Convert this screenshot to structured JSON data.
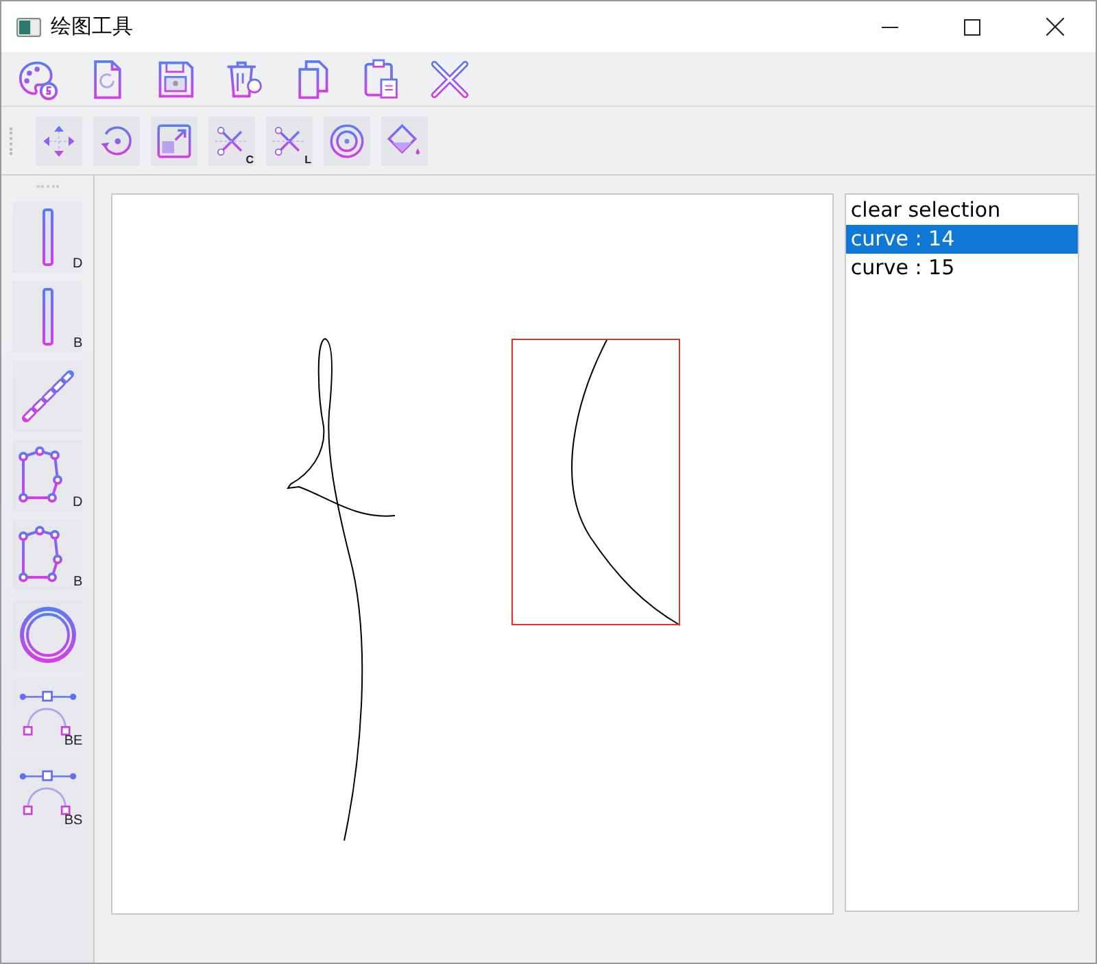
{
  "window": {
    "title": "绘图工具"
  },
  "edit_tools": [
    {
      "kind": "move"
    },
    {
      "kind": "rotate"
    },
    {
      "kind": "scale"
    },
    {
      "kind": "cut",
      "label": "C"
    },
    {
      "kind": "cut",
      "label": "L"
    },
    {
      "kind": "target"
    },
    {
      "kind": "fill"
    }
  ],
  "drawing_tools": [
    {
      "kind": "bar",
      "label": "D"
    },
    {
      "kind": "bar",
      "label": "B"
    },
    {
      "kind": "chain"
    },
    {
      "kind": "polygon",
      "label": "D"
    },
    {
      "kind": "polygon",
      "label": "B"
    },
    {
      "kind": "circle"
    },
    {
      "kind": "bezier",
      "label": "BE"
    },
    {
      "kind": "bezier",
      "label": "BS"
    }
  ],
  "shape_list": [
    {
      "label": "clear selection",
      "selected": false
    },
    {
      "label": "curve : 14",
      "selected": true
    },
    {
      "label": "curve : 15",
      "selected": false
    }
  ]
}
